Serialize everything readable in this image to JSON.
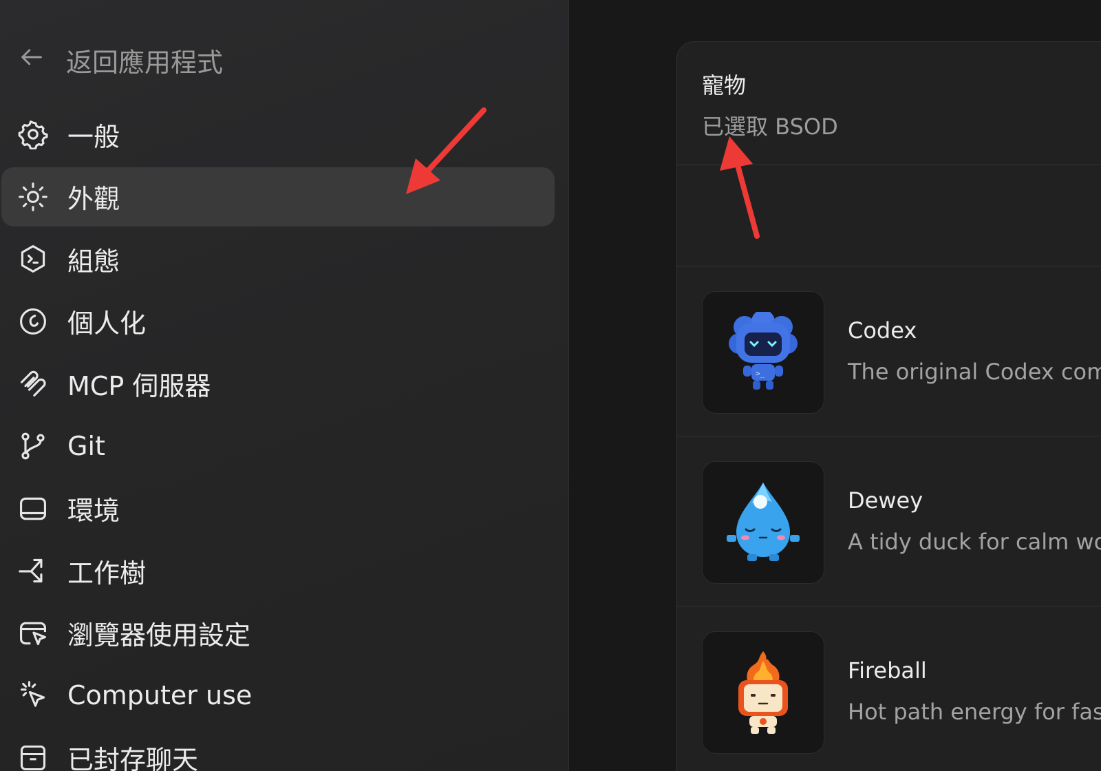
{
  "sidebar": {
    "back_label": "返回應用程式",
    "items": [
      {
        "label": "一般",
        "icon": "gear-icon"
      },
      {
        "label": "外觀",
        "icon": "sun-icon",
        "active": true
      },
      {
        "label": "組態",
        "icon": "shield-terminal-icon"
      },
      {
        "label": "個人化",
        "icon": "smile-circle-icon"
      },
      {
        "label": "MCP 伺服器",
        "icon": "mcp-icon"
      },
      {
        "label": "Git",
        "icon": "git-branch-icon"
      },
      {
        "label": "環境",
        "icon": "display-icon"
      },
      {
        "label": "工作樹",
        "icon": "worktree-icon"
      },
      {
        "label": "瀏覽器使用設定",
        "icon": "browser-cursor-icon"
      },
      {
        "label": "Computer use",
        "icon": "cursor-click-icon"
      },
      {
        "label": "已封存聊天",
        "icon": "archive-icon"
      }
    ]
  },
  "pets": {
    "title": "寵物",
    "selected_text": "已選取 BSOD",
    "items": [
      {
        "name": "Codex",
        "description": "The original Codex com",
        "icon": "codex-robot-icon"
      },
      {
        "name": "Dewey",
        "description": "A tidy duck for calm wo",
        "icon": "water-drop-icon"
      },
      {
        "name": "Fireball",
        "description": "Hot path energy for fas",
        "icon": "fireball-icon"
      }
    ]
  },
  "colors": {
    "accent_arrow": "#ee3a36",
    "sidebar_bg": "#262627",
    "active_item_bg": "#3a3a3b",
    "card_bg": "#212121"
  }
}
